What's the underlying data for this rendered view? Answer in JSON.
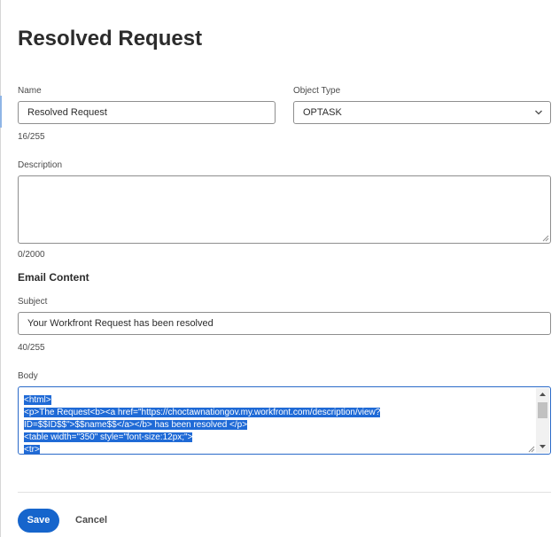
{
  "page": {
    "title": "Resolved Request"
  },
  "form": {
    "name": {
      "label": "Name",
      "value": "Resolved Request",
      "counter": "16/255"
    },
    "object_type": {
      "label": "Object Type",
      "value": "OPTASK"
    },
    "description": {
      "label": "Description",
      "value": "",
      "counter": "0/2000"
    }
  },
  "email": {
    "heading": "Email Content",
    "subject": {
      "label": "Subject",
      "value": "Your Workfront Request has been resolved",
      "counter": "40/255"
    },
    "body": {
      "label": "Body",
      "lines": [
        "<html>",
        "<p>The Request<b><a href=\"https://choctawnationgov.my.workfront.com/description/view?",
        "ID=$$ID$$\">$$name$$</a></b> has been resolved </p>",
        "<table width=\"350\" style=\"font-size:12px;\">",
        "<tr>"
      ]
    }
  },
  "actions": {
    "save_label": "Save",
    "cancel_label": "Cancel"
  },
  "colors": {
    "primary": "#1665cc",
    "selection": "#1f6ad6",
    "focus_border": "#2a6ac9"
  },
  "icons": {
    "select_chevron": "chevron-down-icon",
    "resize": "resize-grip-icon",
    "scroll_up": "scroll-up-arrow-icon",
    "scroll_down": "scroll-down-arrow-icon"
  }
}
